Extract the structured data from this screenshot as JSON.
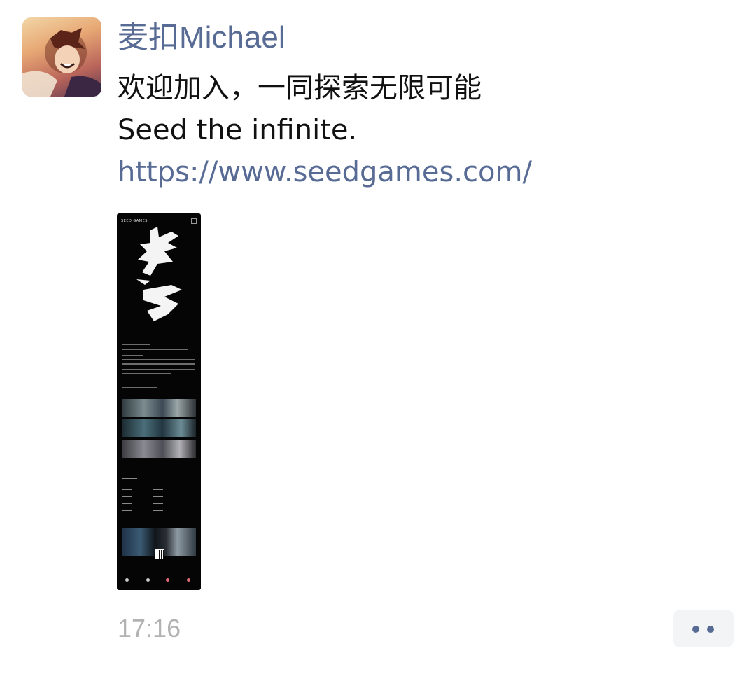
{
  "post": {
    "author": "麦扣Michael",
    "lines": [
      "欢迎加入，一同探索无限可能",
      "Seed the infinite."
    ],
    "link": "https://www.seedgames.com/",
    "time": "17:16"
  },
  "icons": {
    "more": "more-dots-icon"
  },
  "colors": {
    "link": "#576b95",
    "text": "#111111",
    "timestamp": "#b2b2b2"
  }
}
